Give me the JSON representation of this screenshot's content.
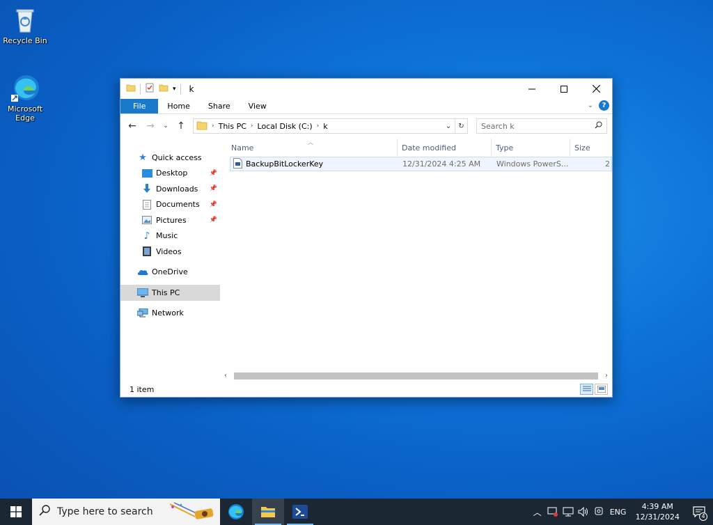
{
  "desktop": {
    "icons": [
      {
        "label": "Recycle Bin"
      },
      {
        "label": "Microsoft Edge"
      }
    ]
  },
  "explorer": {
    "title": "k",
    "ribbon_tabs": [
      "File",
      "Home",
      "Share",
      "View"
    ],
    "breadcrumb": [
      "This PC",
      "Local Disk (C:)",
      "k"
    ],
    "search_placeholder": "Search k",
    "nav": {
      "quick_access": "Quick access",
      "pinned": [
        "Desktop",
        "Downloads",
        "Documents",
        "Pictures"
      ],
      "unpinned": [
        "Music",
        "Videos"
      ],
      "onedrive": "OneDrive",
      "this_pc": "This PC",
      "network": "Network"
    },
    "columns": [
      "Name",
      "Date modified",
      "Type",
      "Size"
    ],
    "files": [
      {
        "name": "BackupBitLockerKey",
        "date": "12/31/2024 4:25 AM",
        "type": "Windows PowerS...",
        "size": "2"
      }
    ],
    "status": "1 item"
  },
  "taskbar": {
    "search_placeholder": "Type here to search",
    "language": "ENG",
    "time": "4:39 AM",
    "date": "12/31/2024",
    "notification_count": "4"
  }
}
